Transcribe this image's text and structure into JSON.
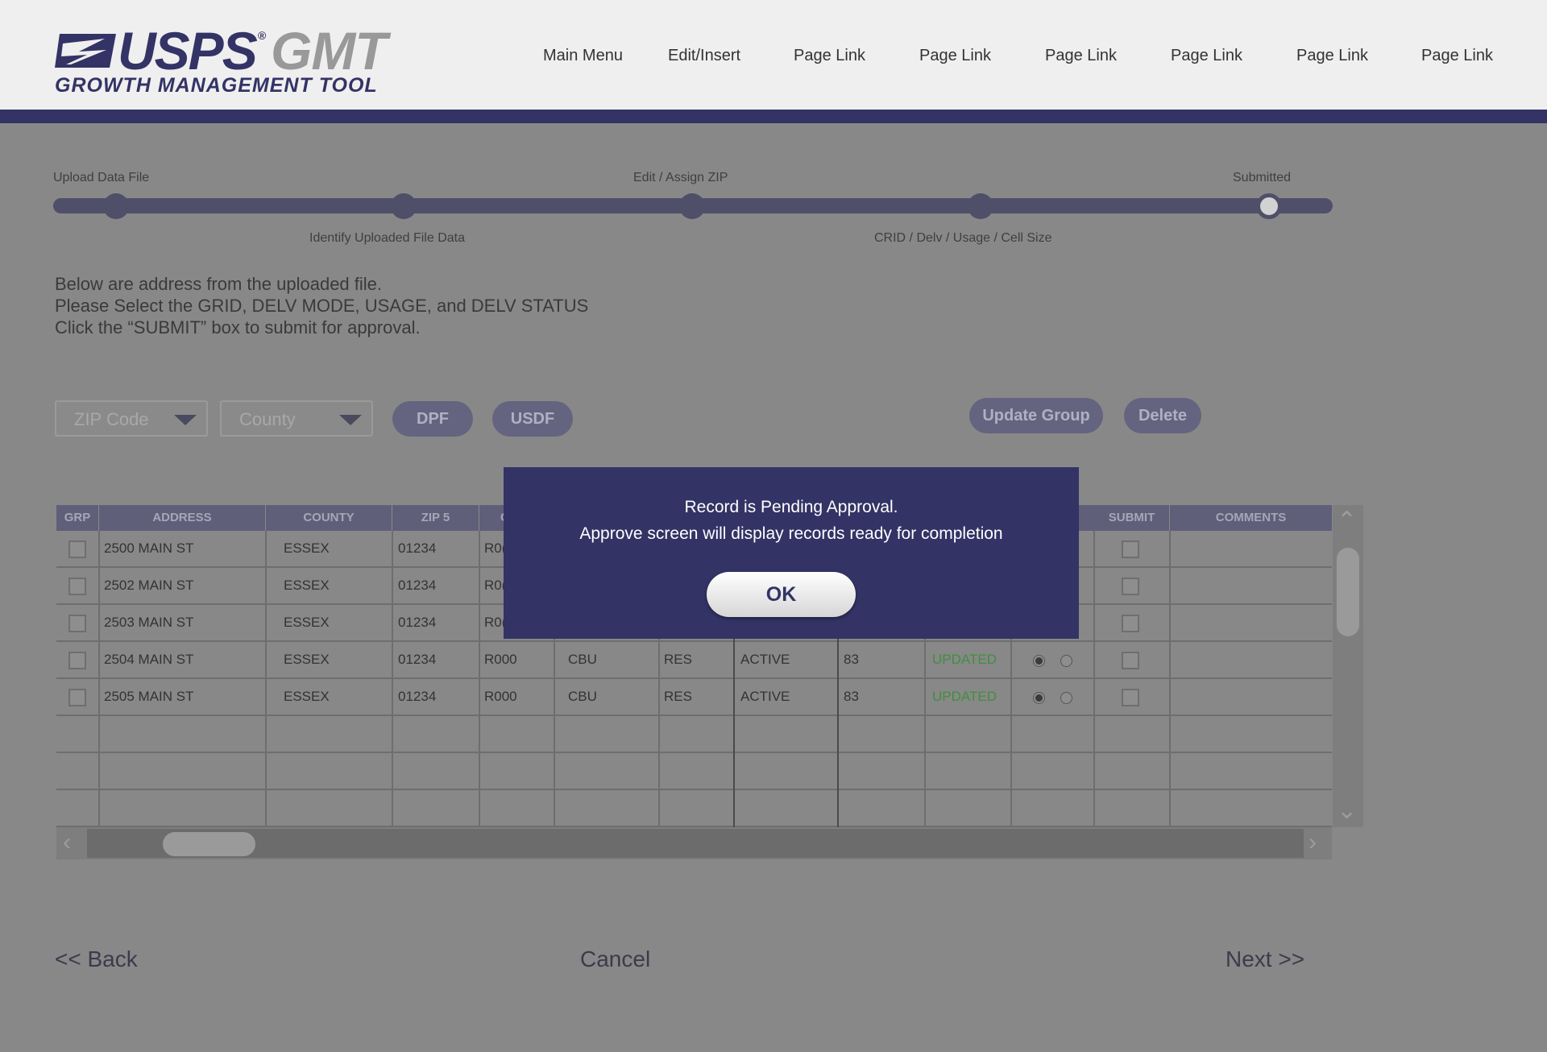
{
  "brand": {
    "name": "USPS",
    "registered": "®",
    "product": "GMT",
    "subtitle": "GROWTH MANAGEMENT TOOL"
  },
  "nav": [
    "Main Menu",
    "Edit/Insert",
    "Page Link",
    "Page Link",
    "Page Link",
    "Page Link",
    "Page Link",
    "Page Link"
  ],
  "progress": {
    "top_labels": [
      "Upload Data File",
      "Edit / Assign ZIP",
      "Submitted"
    ],
    "bottom_labels": [
      "Identify Uploaded File Data",
      "CRID / Delv / Usage / Cell Size"
    ],
    "current_step": 5,
    "total_steps": 5
  },
  "instructions": [
    "Below are address from the uploaded file.",
    "Please Select the GRID, DELV MODE, USAGE, and DELV STATUS",
    "Click the “SUBMIT” box to submit for approval."
  ],
  "filters": {
    "zip_placeholder": "ZIP Code",
    "county_placeholder": "County",
    "dpf": "DPF",
    "usdf": "USDF",
    "update_group": "Update Group",
    "delete": "Delete"
  },
  "table": {
    "headers": [
      "GRP",
      "ADDRESS",
      "COUNTY",
      "ZIP 5",
      "C",
      "SUBMIT",
      "COMMENTS"
    ],
    "rows": [
      {
        "address": "2500 MAIN ST",
        "county": "ESSEX",
        "zip": "01234",
        "crid": "R0(",
        "mode": "",
        "usage": "",
        "status": "",
        "size": "",
        "state": "",
        "radio": false
      },
      {
        "address": "2502 MAIN ST",
        "county": "ESSEX",
        "zip": "01234",
        "crid": "R0(",
        "mode": "",
        "usage": "",
        "status": "",
        "size": "",
        "state": "",
        "radio": false
      },
      {
        "address": "2503 MAIN ST",
        "county": "ESSEX",
        "zip": "01234",
        "crid": "R0(",
        "mode": "",
        "usage": "",
        "status": "",
        "size": "",
        "state": "",
        "radio": false
      },
      {
        "address": "2504 MAIN ST",
        "county": "ESSEX",
        "zip": "01234",
        "crid": "R000",
        "mode": "CBU",
        "usage": "RES",
        "status": "ACTIVE",
        "size": "83",
        "state": "UPDATED",
        "radio": true
      },
      {
        "address": "2505 MAIN ST",
        "county": "ESSEX",
        "zip": "01234",
        "crid": "R000",
        "mode": "CBU",
        "usage": "RES",
        "status": "ACTIVE",
        "size": "83",
        "state": "UPDATED",
        "radio": true
      }
    ]
  },
  "footer": {
    "back": "<< Back",
    "cancel": "Cancel",
    "next": "Next >>"
  },
  "modal": {
    "line1": "Record is Pending Approval.",
    "line2": "Approve screen will display records ready for completion",
    "ok": "OK"
  },
  "colors": {
    "brand_navy": "#333366",
    "overlay_gray": "#888888",
    "updated_green": "#3f8f3f"
  }
}
